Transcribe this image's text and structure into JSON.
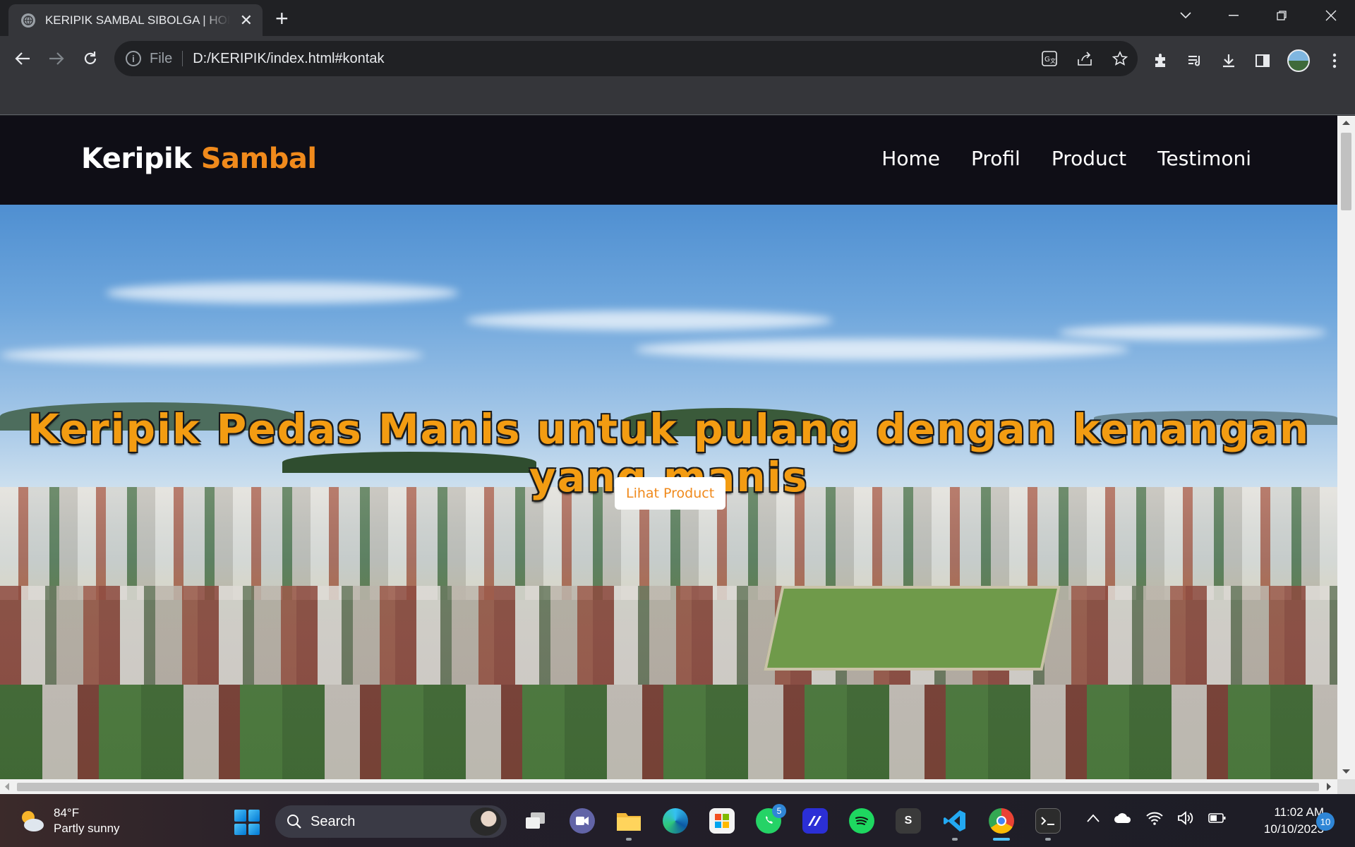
{
  "browser": {
    "tab_title": "KERIPIK SAMBAL SIBOLGA | HOME",
    "tab_close": "✕",
    "new_tab": "+",
    "scheme": "File",
    "url": "D:/KERIPIK/index.html#kontak",
    "icons": [
      "back-arrow-icon",
      "forward-arrow-icon",
      "reload-icon",
      "info-icon",
      "translate-icon",
      "share-icon",
      "star-icon",
      "extensions-icon",
      "media-icon",
      "download-icon",
      "side-panel-icon",
      "avatar",
      "more-vert-icon"
    ]
  },
  "site": {
    "logo_main": "Keripik",
    "logo_accent": "Sambal",
    "accent_color": "#f08a1c",
    "nav": [
      {
        "label": "Home"
      },
      {
        "label": "Profil"
      },
      {
        "label": "Product"
      },
      {
        "label": "Testimoni"
      }
    ],
    "hero_title": "Keripik Pedas Manis untuk pulang dengan kenangan yang manis",
    "cta_label": "Lihat Product"
  },
  "taskbar": {
    "weather_temp": "84°F",
    "weather_desc": "Partly sunny",
    "search_label": "Search",
    "whatsapp_badge": "5",
    "clock_time": "11:02 AM",
    "clock_date": "10/10/2023",
    "notifications": "10"
  }
}
